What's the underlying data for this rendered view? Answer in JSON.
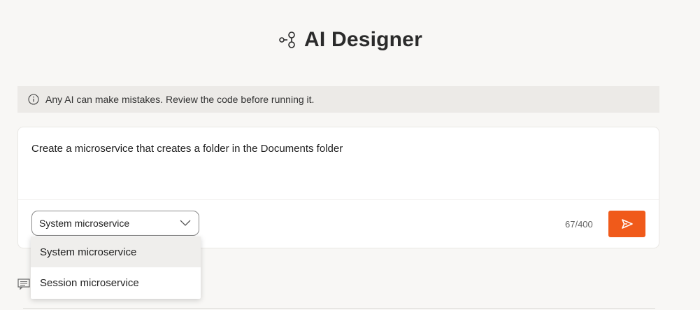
{
  "header": {
    "title": "AI Designer",
    "logo_icon": "graph-nodes-icon"
  },
  "banner": {
    "icon": "info-icon",
    "text": "Any AI can make mistakes. Review the code before running it."
  },
  "prompt": {
    "text": "Create a microservice that creates a folder in the Documents folder",
    "char_count": "67/400"
  },
  "select": {
    "value": "System microservice",
    "options": [
      {
        "label": "System microservice",
        "selected": true
      },
      {
        "label": "Session microservice",
        "selected": false
      }
    ]
  },
  "send_button": {
    "icon": "send-icon",
    "color": "#f05a1a"
  },
  "below": {
    "icon": "chat-bubble-icon"
  },
  "colors": {
    "accent": "#f05a1a",
    "background": "#f8f7f5",
    "banner": "#eceae7"
  }
}
